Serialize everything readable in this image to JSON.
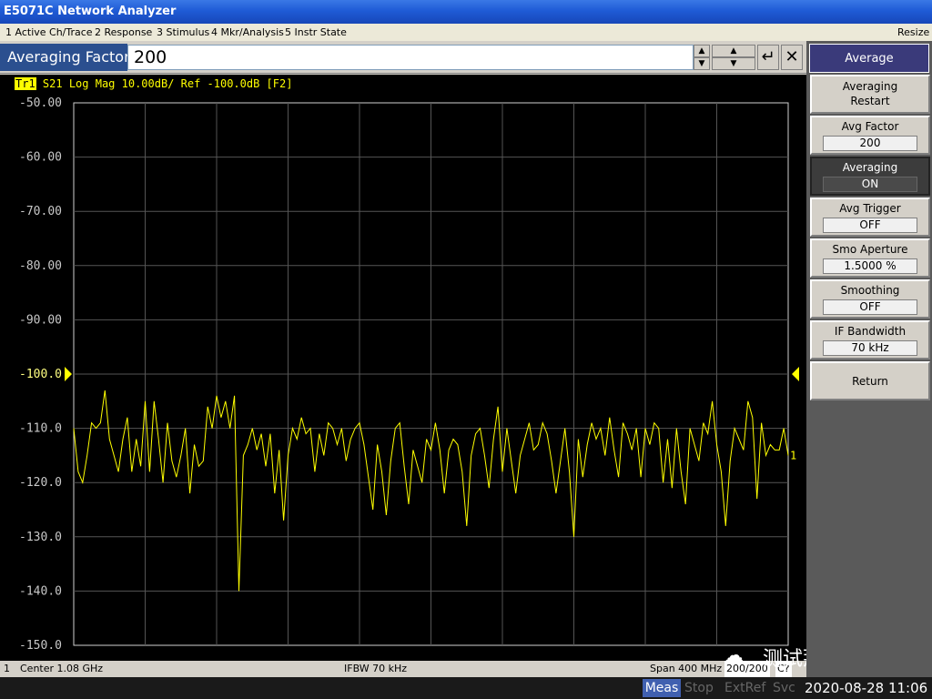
{
  "window": {
    "title": "E5071C Network Analyzer"
  },
  "menu": {
    "items": [
      "1 Active Ch/Trace",
      "2 Response",
      "3 Stimulus",
      "4 Mkr/Analysis",
      "5 Instr State"
    ],
    "resize": "Resize"
  },
  "entry": {
    "label": "Averaging Factor",
    "value": "200"
  },
  "trace": {
    "badge": "Tr1",
    "header": "S21 Log Mag 10.00dB/ Ref -100.0dB [F2]",
    "marker_label": "1"
  },
  "chart_data": {
    "type": "line",
    "yticks": [
      "-50.00",
      "-60.00",
      "-70.00",
      "-80.00",
      "-90.00",
      "-100.0",
      "-110.0",
      "-120.0",
      "-130.0",
      "-140.0",
      "-150.0"
    ],
    "ylim": [
      -150,
      -50
    ],
    "ref_level": -100,
    "series": [
      {
        "color": "#ffff00",
        "values": [
          -110,
          -118,
          -120,
          -115,
          -109,
          -110,
          -109,
          -103,
          -112,
          -115,
          -118,
          -112,
          -108,
          -118,
          -112,
          -117,
          -105,
          -118,
          -105,
          -112,
          -120,
          -109,
          -116,
          -119,
          -115,
          -110,
          -122,
          -113,
          -117,
          -116,
          -106,
          -110,
          -104,
          -108,
          -105,
          -110,
          -104,
          -140,
          -115,
          -113,
          -110,
          -114,
          -111,
          -117,
          -111,
          -122,
          -114,
          -127,
          -115,
          -110,
          -112,
          -108,
          -111,
          -110,
          -118,
          -111,
          -115,
          -109,
          -110,
          -113,
          -110,
          -116,
          -112,
          -110,
          -109,
          -113,
          -119,
          -125,
          -113,
          -118,
          -126,
          -116,
          -110,
          -109,
          -117,
          -124,
          -114,
          -117,
          -120,
          -112,
          -114,
          -109,
          -114,
          -122,
          -114,
          -112,
          -113,
          -118,
          -128,
          -115,
          -111,
          -110,
          -115,
          -121,
          -112,
          -106,
          -118,
          -110,
          -116,
          -122,
          -115,
          -112,
          -109,
          -114,
          -113,
          -109,
          -111,
          -116,
          -122,
          -116,
          -110,
          -118,
          -130,
          -112,
          -119,
          -113,
          -109,
          -112,
          -110,
          -115,
          -108,
          -114,
          -119,
          -109,
          -111,
          -114,
          -110,
          -119,
          -110,
          -113,
          -109,
          -110,
          -120,
          -112,
          -121,
          -110,
          -118,
          -124,
          -110,
          -113,
          -116,
          -109,
          -111,
          -105,
          -113,
          -118,
          -128,
          -116,
          -110,
          -112,
          -114,
          -105,
          -108,
          -123,
          -109,
          -115,
          -113,
          -114,
          -114,
          -110,
          -115
        ]
      }
    ]
  },
  "status": {
    "channel": "1",
    "center": "Center 1.08 GHz",
    "ifbw": "IFBW 70 kHz",
    "span": "Span 400 MHz",
    "avg_count": "200/200",
    "correction": "C?"
  },
  "bottom": {
    "meas": "Meas",
    "stop": "Stop",
    "extref": "ExtRef",
    "svc": "Svc",
    "datetime": "2020-08-28 11:06",
    "watermark": "测试那些事儿"
  },
  "softkeys": {
    "title": "Average",
    "items": [
      {
        "label": "Averaging Restart",
        "value": null
      },
      {
        "label": "Avg Factor",
        "value": "200"
      },
      {
        "label": "Averaging",
        "value": "ON"
      },
      {
        "label": "Avg Trigger",
        "value": "OFF"
      },
      {
        "label": "Smo Aperture",
        "value": "1.5000  %"
      },
      {
        "label": "Smoothing",
        "value": "OFF"
      },
      {
        "label": "IF Bandwidth",
        "value": "70 kHz"
      },
      {
        "label": "Return",
        "value": null
      }
    ]
  }
}
